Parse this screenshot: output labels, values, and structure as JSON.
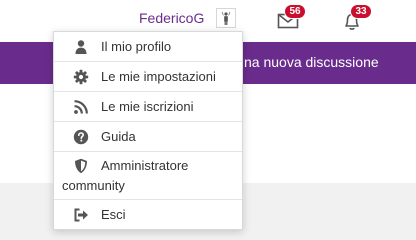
{
  "header": {
    "username": "FedericoG",
    "messages_count": "56",
    "notifications_count": "33",
    "avatar_icon": "user-avatar-icon",
    "mail_icon": "envelope-icon",
    "bell_icon": "bell-icon"
  },
  "band": {
    "new_discussion_label": "na nuova discussione"
  },
  "menu": {
    "items": [
      {
        "label": "Il mio profilo",
        "icon": "user-icon"
      },
      {
        "label": "Le mie impostazioni",
        "icon": "gear-icon"
      },
      {
        "label": "Le mie iscrizioni",
        "icon": "rss-icon"
      },
      {
        "label": "Guida",
        "icon": "question-circle-icon"
      },
      {
        "label_line1": "Amministratore",
        "label_line2": "community",
        "icon": "shield-icon"
      },
      {
        "label": "Esci",
        "icon": "sign-out-icon"
      }
    ]
  },
  "colors": {
    "brand_purple": "#6a2c8c",
    "badge_red": "#c8102e",
    "icon_gray": "#555555",
    "footer_gray": "#f1f1f1"
  }
}
